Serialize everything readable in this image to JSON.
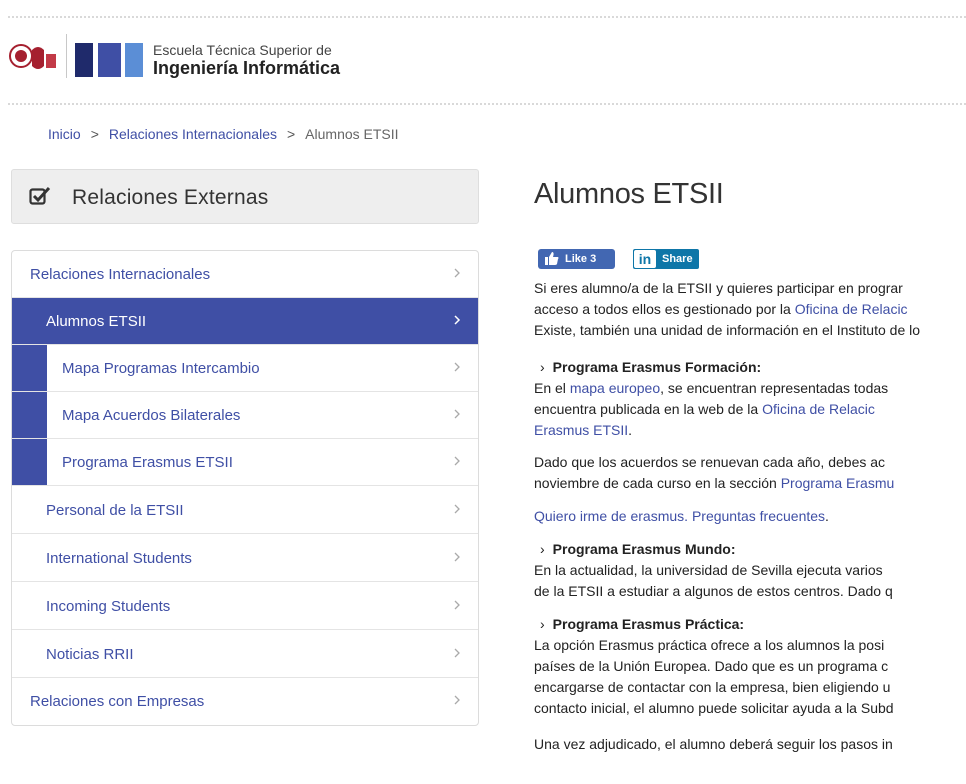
{
  "header": {
    "school_line1": "Escuela Técnica Superior de",
    "school_line2": "Ingeniería Informática",
    "logo_colors": [
      "#1f2a6b",
      "#3f4fa5",
      "#5b8ed6"
    ]
  },
  "breadcrumb": {
    "items": [
      "Inicio",
      "Relaciones Internacionales",
      "Alumnos ETSII"
    ],
    "separator": ">"
  },
  "sidebar": {
    "header_title": "Relaciones Externas",
    "header_icon": "checkbox-icon",
    "items": [
      {
        "label": "Relaciones Internacionales"
      },
      {
        "label": "Alumnos ETSII"
      },
      {
        "label": "Mapa Programas Intercambio"
      },
      {
        "label": "Mapa Acuerdos Bilaterales"
      },
      {
        "label": "Programa Erasmus ETSII"
      },
      {
        "label": "Personal de la ETSII"
      },
      {
        "label": "International Students"
      },
      {
        "label": "Incoming Students"
      },
      {
        "label": "Noticias RRII"
      },
      {
        "label": "Relaciones con Empresas"
      }
    ],
    "active_color": "#3f4fa5"
  },
  "main": {
    "title": "Alumnos ETSII",
    "fb_like": "Like 3",
    "li_share": "Share",
    "intro": {
      "l1": "Si eres alumno/a de la ETSII y quieres participar en prograr",
      "l2a": "acceso a todos ellos es gestionado por la ",
      "l2link": "Oficina de Relacic",
      "l3": "Existe, también una unidad de información en el Instituto de lo"
    },
    "erasmus_formacion": {
      "heading": "Programa Erasmus Formación:",
      "l1a": "En el ",
      "l1link": "mapa europeo",
      "l1b": ", se encuentran representadas todas",
      "l2a": "encuentra publicada en la web de la ",
      "l2link": "Oficina de Relacic",
      "l3link": "Erasmus ETSII",
      "l3b": ".",
      "p2l1": "Dado que los acuerdos se renuevan cada año, debes ac",
      "p2l2a": "noviembre de cada curso en la sección ",
      "p2l2link": "Programa Erasmu",
      "faq_link": "Quiero irme de erasmus. Preguntas frecuentes",
      "faq_after": "."
    },
    "erasmus_mundo": {
      "heading": "Programa Erasmus Mundo:",
      "l1": "En la actualidad, la universidad de Sevilla ejecuta varios",
      "l2": "de la ETSII a estudiar a algunos de estos centros. Dado q"
    },
    "erasmus_practica": {
      "heading": "Programa Erasmus Práctica:",
      "l1": "La opción Erasmus práctica ofrece a los alumnos la posi",
      "l2": "países de la Unión Europea. Dado que es un programa c",
      "l3": "encargarse de contactar con la empresa, bien eligiendo u",
      "l4": "contacto inicial, el alumno puede solicitar ayuda a la Subd",
      "l5": "Una vez adjudicado, el alumno deberá seguir los pasos in"
    }
  }
}
